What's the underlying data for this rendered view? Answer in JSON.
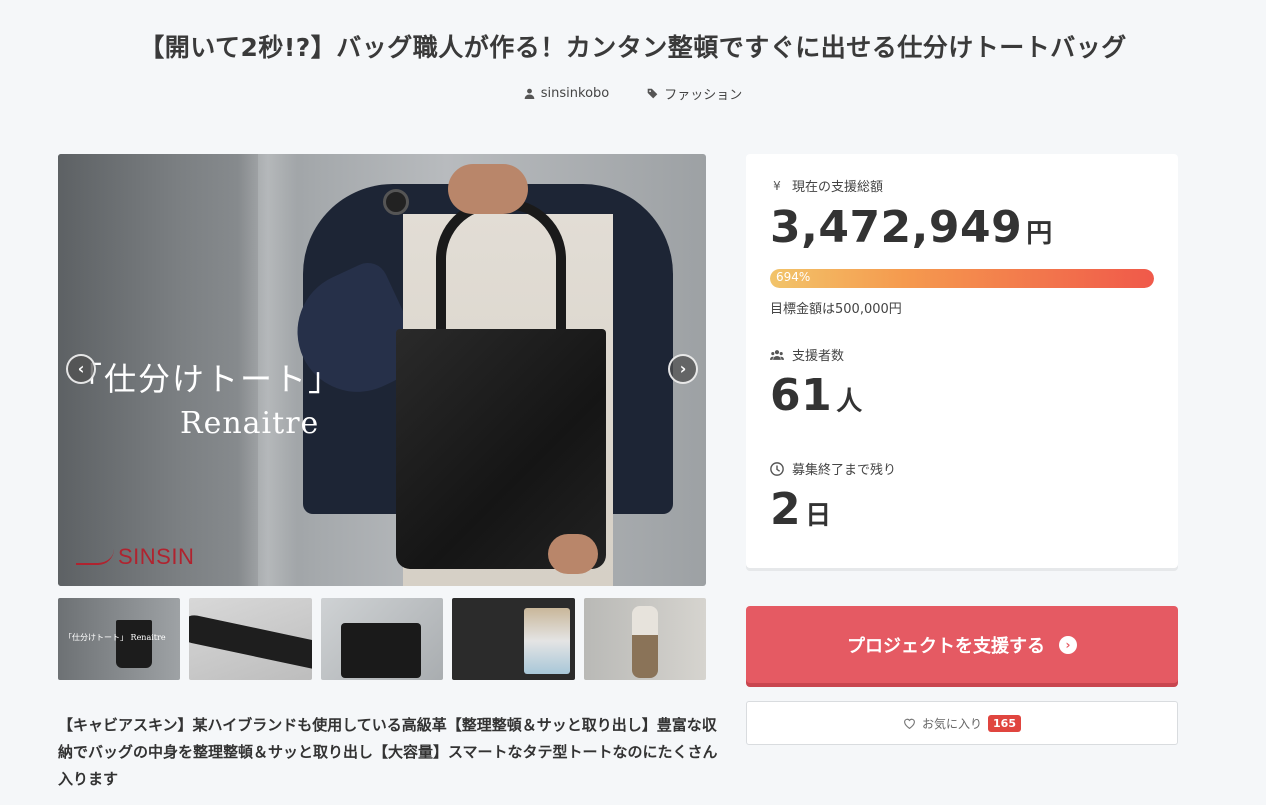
{
  "project": {
    "title": "【開いて2秒!?】バッグ職人が作る！カンタン整頓ですぐに出せる仕分けトートバッグ",
    "author": "sinsinkobo",
    "category": "ファッション"
  },
  "hero": {
    "caption_line1": "「仕分けトート」",
    "caption_line2": "Renaitre",
    "brand": "SINSIN",
    "prev_label": "‹",
    "next_label": "›"
  },
  "thumbnails": [
    {
      "label": "「仕分けトート」 Renaitre"
    },
    {
      "label": ""
    },
    {
      "label": ""
    },
    {
      "label": ""
    },
    {
      "label": ""
    }
  ],
  "description": "【キャビアスキン】某ハイブランドも使用している高級革【整理整頓＆サッと取り出し】豊富な収納でバッグの中身を整理整頓＆サッと取り出し【大容量】スマートなタテ型トートなのにたくさん入ります",
  "stats": {
    "total_label": "現在の支援総額",
    "total_amount": "3,472,949",
    "total_unit": "円",
    "progress_text": "694%",
    "progress_percent": 694,
    "goal_text": "目標金額は500,000円",
    "supporters_label": "支援者数",
    "supporters_count": "61",
    "supporters_unit": "人",
    "remaining_label": "募集終了まで残り",
    "remaining_count": "2",
    "remaining_unit": "日"
  },
  "actions": {
    "support_label": "プロジェクトを支援する",
    "favorite_label": "お気に入り",
    "favorite_count": "165"
  },
  "colors": {
    "accent": "#e55a63",
    "badge": "#e0453f",
    "background": "#f5f7f9"
  }
}
